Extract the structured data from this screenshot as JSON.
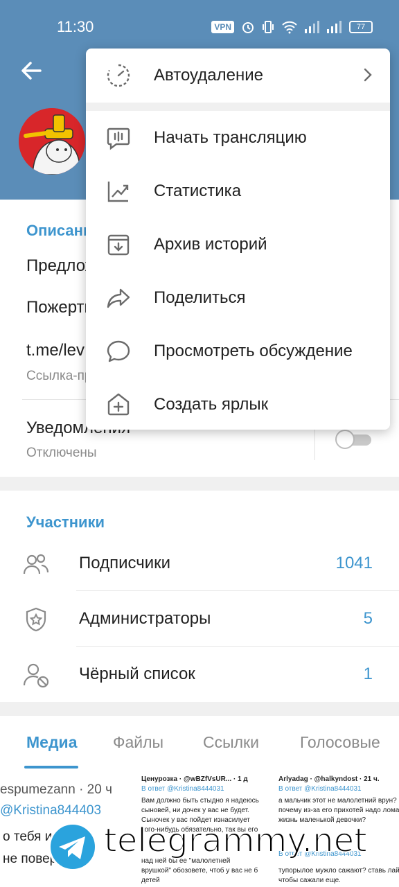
{
  "status_bar": {
    "time": "11:30",
    "vpn": "VPN",
    "battery": "77"
  },
  "info": {
    "description_title": "Описание",
    "offer_text": "Предложка",
    "donate_text": "Пожертвовать",
    "link_text": "t.me/lev",
    "link_caption": "Ссылка-приглашение",
    "notifications_label": "Уведомления",
    "notifications_value": "Отключены"
  },
  "members": {
    "title": "Участники",
    "rows": [
      {
        "label": "Подписчики",
        "count": "1041",
        "icon": "people-icon"
      },
      {
        "label": "Администраторы",
        "count": "5",
        "icon": "admin-shield-icon"
      },
      {
        "label": "Чёрный список",
        "count": "1",
        "icon": "blocked-user-icon"
      }
    ]
  },
  "media_tabs": [
    "Медиа",
    "Файлы",
    "Ссылки",
    "Голосовые"
  ],
  "thumbs": {
    "t1": [
      "espumezann · 20 ч",
      "@Kristina844403",
      "о тебя и",
      "не повер"
    ],
    "t2": [
      "Ценурозка · @wBZfVsUR... · 1 д",
      "В ответ @Kristina8444031",
      "Вам должно быть стыдно я надеюсь",
      "сыновей, ни дочек у вас не будет.",
      "Сыночек у вас пойдет изнасилует",
      "кого-нибудь обязательно, так вы его",
      "над ней бы ее \"малолетней",
      "врушкой\" обозовете, чтоб у вас не б",
      "детей"
    ],
    "t3": [
      "Arlyadag · @halkyndost · 21 ч.",
      "В ответ @Kristina8444031",
      "а мальчик этот не малолетний врун?",
      "почему из-за его прихотей надо лома",
      "жизнь маленькой девочки?",
      "В ответ @Kristina8444031",
      "тупорылое мужло сажают? ставь лай",
      "чтобы сажали еще."
    ]
  },
  "watermark": "telegrammy.net",
  "menu": {
    "auto_delete": "Автоудаление",
    "items": [
      {
        "label": "Начать трансляцию",
        "icon": "live-stream-icon"
      },
      {
        "label": "Статистика",
        "icon": "statistics-icon"
      },
      {
        "label": "Архив историй",
        "icon": "stories-archive-icon"
      },
      {
        "label": "Поделиться",
        "icon": "share-icon"
      },
      {
        "label": "Просмотреть обсуждение",
        "icon": "discussion-icon"
      },
      {
        "label": "Создать ярлык",
        "icon": "shortcut-icon"
      }
    ]
  },
  "colors": {
    "header": "#5b8db8",
    "accent": "#3d95ce"
  }
}
